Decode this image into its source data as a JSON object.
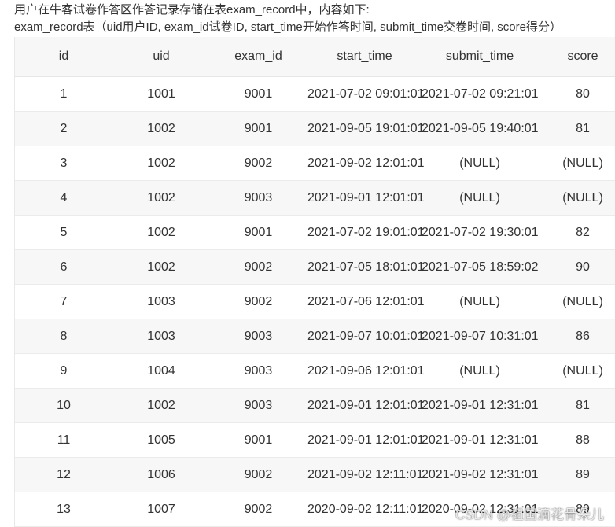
{
  "intro": {
    "line1": "用户在牛客试卷作答区作答记录存储在表exam_record中，内容如下:",
    "line2": "exam_record表（uid用户ID, exam_id试卷ID, start_time开始作答时间, submit_time交卷时间, score得分）"
  },
  "table": {
    "headers": [
      "id",
      "uid",
      "exam_id",
      "start_time",
      "submit_time",
      "score"
    ],
    "rows": [
      [
        "1",
        "1001",
        "9001",
        "2021-07-02 09:01:01",
        "2021-07-02 09:21:01",
        "80"
      ],
      [
        "2",
        "1002",
        "9001",
        "2021-09-05 19:01:01",
        "2021-09-05 19:40:01",
        "81"
      ],
      [
        "3",
        "1002",
        "9002",
        "2021-09-02 12:01:01",
        "(NULL)",
        "(NULL)"
      ],
      [
        "4",
        "1002",
        "9003",
        "2021-09-01 12:01:01",
        "(NULL)",
        "(NULL)"
      ],
      [
        "5",
        "1002",
        "9001",
        "2021-07-02 19:01:01",
        "2021-07-02 19:30:01",
        "82"
      ],
      [
        "6",
        "1002",
        "9002",
        "2021-07-05 18:01:01",
        "2021-07-05 18:59:02",
        "90"
      ],
      [
        "7",
        "1003",
        "9002",
        "2021-07-06 12:01:01",
        "(NULL)",
        "(NULL)"
      ],
      [
        "8",
        "1003",
        "9003",
        "2021-09-07 10:01:01",
        "2021-09-07 10:31:01",
        "86"
      ],
      [
        "9",
        "1004",
        "9003",
        "2021-09-06 12:01:01",
        "(NULL)",
        "(NULL)"
      ],
      [
        "10",
        "1002",
        "9003",
        "2021-09-01 12:01:01",
        "2021-09-01 12:31:01",
        "81"
      ],
      [
        "11",
        "1005",
        "9001",
        "2021-09-01 12:01:01",
        "2021-09-01 12:31:01",
        "88"
      ],
      [
        "12",
        "1006",
        "9002",
        "2021-09-02 12:11:01",
        "2021-09-02 12:31:01",
        "89"
      ],
      [
        "13",
        "1007",
        "9002",
        "2020-09-02 12:11:01",
        "2020-09-02 12:31:01",
        "89"
      ]
    ]
  },
  "watermark": "CSDN @祖国滴花骨朵儿"
}
